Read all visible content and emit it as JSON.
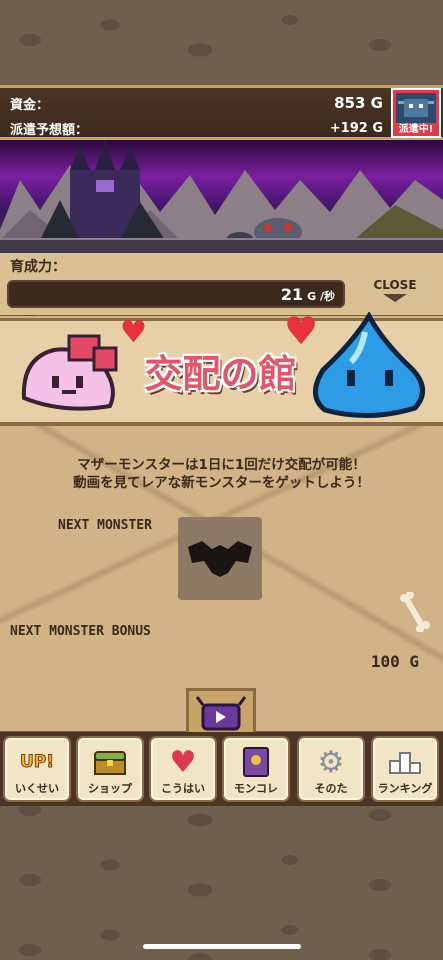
{
  "status": {
    "funds_label": "資金：",
    "funds_value": "853 G",
    "dispatch_label": "派遣予想額：",
    "dispatch_value": "+192 G",
    "dispatch_tag": "派遣中!"
  },
  "growth": {
    "label": "育成力：",
    "value": "21",
    "unit": "G /秒"
  },
  "close_label": "CLOSE",
  "title": "交配の館",
  "description_line1": "マザーモンスターは1日に1回だけ交配が可能！",
  "description_line2": "動画を見てレアな新モンスターをゲットしよう！",
  "next_monster_label": "NEXT MONSTER",
  "next_bonus_label": "NEXT MONSTER BONUS",
  "next_bonus_value": "100 G",
  "nav": [
    {
      "label": "いくせい",
      "icon": "up-icon"
    },
    {
      "label": "ショップ",
      "icon": "treasure-chest-icon"
    },
    {
      "label": "こうはい",
      "icon": "heart-icon"
    },
    {
      "label": "モンコレ",
      "icon": "book-icon"
    },
    {
      "label": "そのた",
      "icon": "gear-icon"
    },
    {
      "label": "ランキング",
      "icon": "podium-icon"
    }
  ],
  "nav_up_text": "UP!",
  "colors": {
    "title": "#e0566a",
    "status_bg": "#3c2a1d",
    "parchment": "#d2b287",
    "dispatch_tag_bg": "#e13a48"
  }
}
